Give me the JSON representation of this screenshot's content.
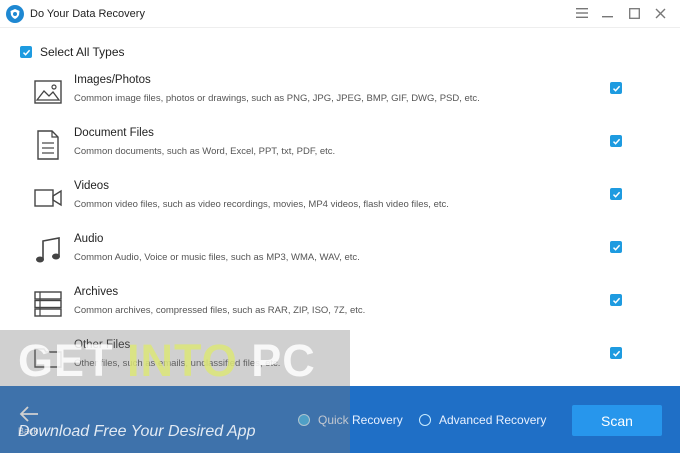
{
  "app": {
    "title": "Do Your Data Recovery",
    "accent": "#1e9be0",
    "bottom_bar_color": "#1f6fc6",
    "icon": "shield-logo-icon"
  },
  "window_controls": [
    "menu-icon",
    "minimize-icon",
    "maximize-icon",
    "close-icon"
  ],
  "select_all": {
    "label": "Select All Types",
    "checked": true
  },
  "types": [
    {
      "title": "Images/Photos",
      "desc": "Common image files, photos or drawings, such as PNG, JPG, JPEG, BMP, GIF, DWG, PSD, etc.",
      "icon": "image-icon",
      "checked": true
    },
    {
      "title": "Document Files",
      "desc": "Common documents, such as Word, Excel, PPT, txt, PDF, etc.",
      "icon": "document-icon",
      "checked": true
    },
    {
      "title": "Videos",
      "desc": "Common video files, such as video recordings, movies, MP4 videos, flash video files, etc.",
      "icon": "video-camera-icon",
      "checked": true
    },
    {
      "title": "Audio",
      "desc": "Common Audio, Voice or music files, such as MP3, WMA, WAV, etc.",
      "icon": "music-note-icon",
      "checked": true
    },
    {
      "title": "Archives",
      "desc": "Common archives, compressed files, such as RAR, ZIP, ISO, 7Z, etc.",
      "icon": "archive-icon",
      "checked": true
    },
    {
      "title": "Other Files",
      "desc": "Other files, such as emails, unclassified files, etc.",
      "icon": "folder-icon",
      "checked": true
    }
  ],
  "bottom": {
    "back_label": "Back",
    "quick_recovery": "Quick Recovery",
    "advanced_recovery": "Advanced Recovery",
    "selected_mode": "Quick Recovery",
    "scan_label": "Scan"
  },
  "watermark": {
    "line1_a": "GET ",
    "line1_b": "INTO",
    "line1_c": " PC",
    "line2": "Download Free Your Desired App"
  }
}
